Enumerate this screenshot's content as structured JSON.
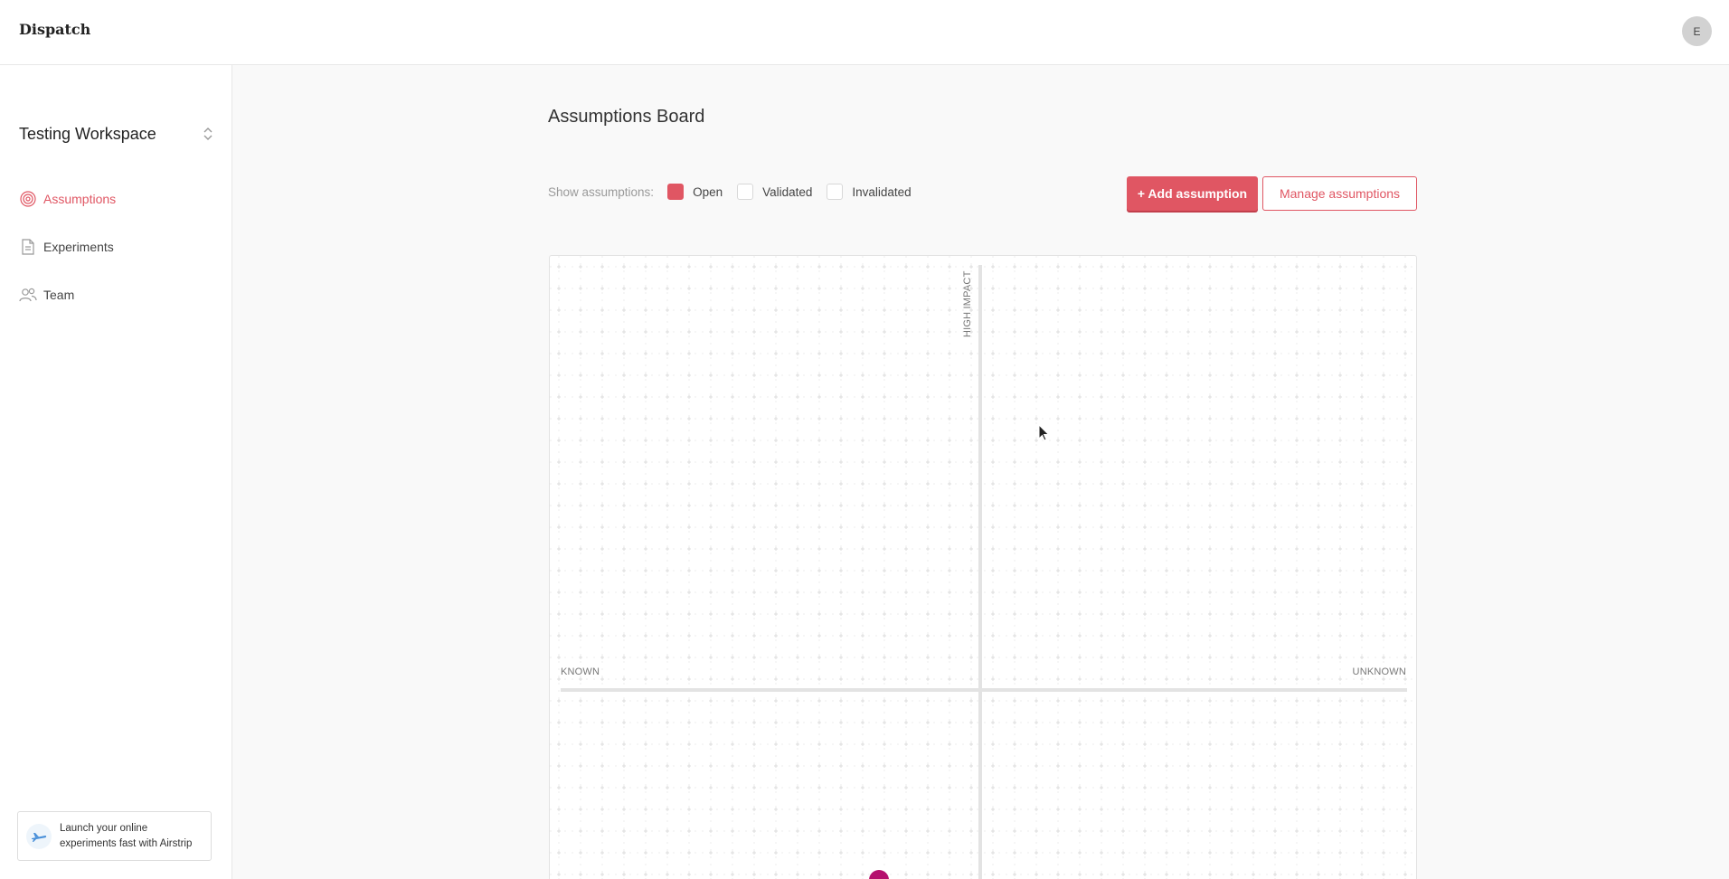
{
  "header": {
    "brand": "Dispatch",
    "avatar_initial": "E"
  },
  "sidebar": {
    "workspace_name": "Testing Workspace",
    "items": [
      {
        "label": "Assumptions",
        "icon": "target-icon",
        "active": true
      },
      {
        "label": "Experiments",
        "icon": "document-icon",
        "active": false
      },
      {
        "label": "Team",
        "icon": "users-icon",
        "active": false
      }
    ],
    "promo": {
      "icon": "airplane-icon",
      "text": "Launch your online experiments fast with Airstrip"
    }
  },
  "main": {
    "title": "Assumptions Board",
    "filters": {
      "label": "Show assumptions:",
      "options": [
        {
          "label": "Open",
          "checked": true
        },
        {
          "label": "Validated",
          "checked": false
        },
        {
          "label": "Invalidated",
          "checked": false
        }
      ]
    },
    "add_button": "+ Add assumption",
    "manage_button": "Manage assumptions",
    "board": {
      "y_label_top": "HIGH IMPACT",
      "x_label_left": "KNOWN",
      "x_label_right": "UNKNOWN",
      "marker_color": "#b5106e"
    }
  },
  "colors": {
    "accent": "#e05663",
    "marker": "#b5106e"
  }
}
